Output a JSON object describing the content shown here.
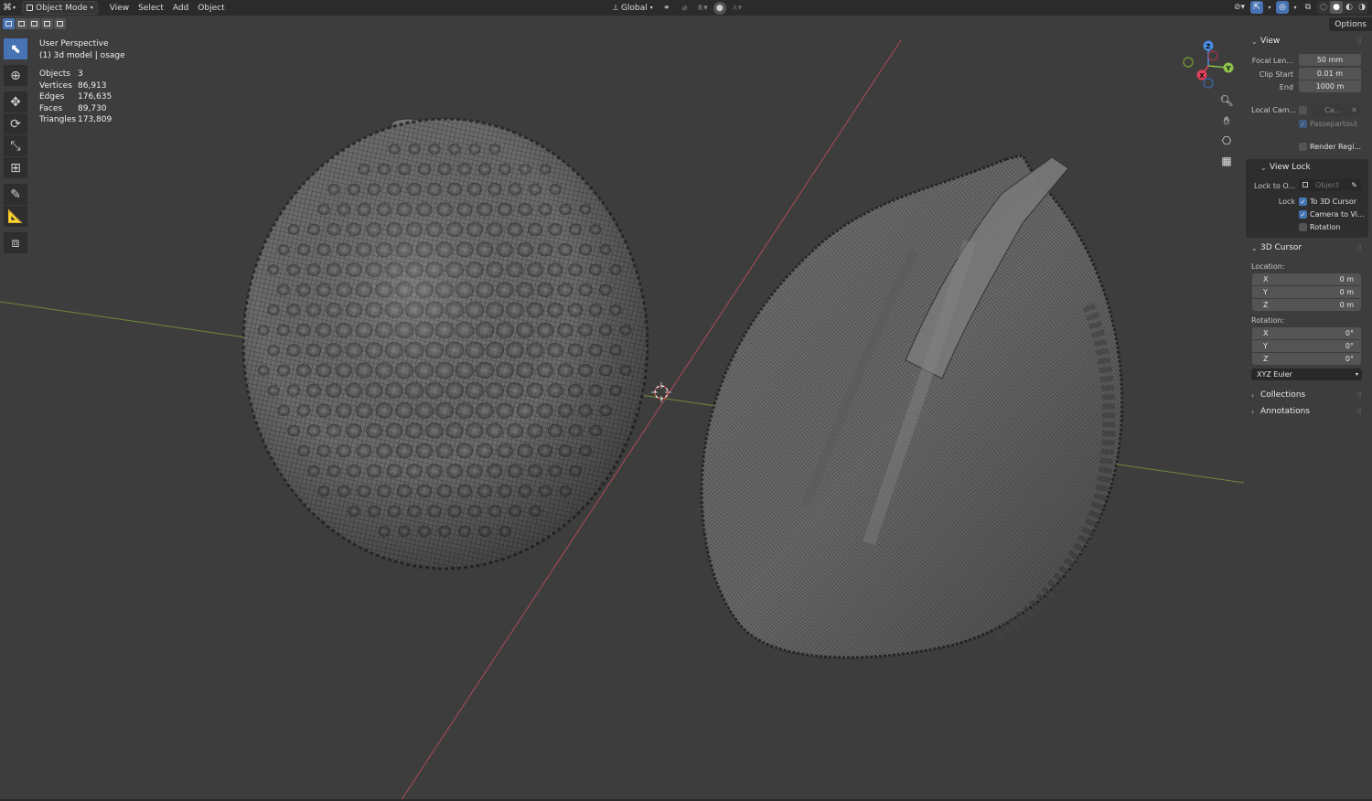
{
  "header": {
    "editor_icon": "3d-viewport-icon",
    "mode": "Object Mode",
    "menus": [
      "View",
      "Select",
      "Add",
      "Object"
    ],
    "transform_orientation": "Global"
  },
  "subrow": {
    "options_label": "Options"
  },
  "overlay": {
    "view_name": "User Perspective",
    "collection_object": "(1) 3d model | osage",
    "stats": [
      {
        "label": "Objects",
        "value": "3"
      },
      {
        "label": "Vertices",
        "value": "86,913"
      },
      {
        "label": "Edges",
        "value": "176,635"
      },
      {
        "label": "Faces",
        "value": "89,730"
      },
      {
        "label": "Triangles",
        "value": "173,809"
      }
    ]
  },
  "gizmo": {
    "z": "Z",
    "y": "Y",
    "x": "X",
    "colors": {
      "x": "#e0405a",
      "y": "#8bc34a",
      "z": "#4a8be0"
    }
  },
  "sidebar": {
    "view": {
      "title": "View",
      "focal_label": "Focal Len...",
      "focal_value": "50 mm",
      "clip_start_label": "Clip Start",
      "clip_start_value": "0.01 m",
      "clip_end_label": "End",
      "clip_end_value": "1000 m",
      "local_camera_label": "Local Cam...",
      "local_camera_value": "Ca...",
      "passepartout_label": "Passepartout",
      "render_region_label": "Render Regi..."
    },
    "view_lock": {
      "title": "View Lock",
      "lock_to_object_label": "Lock to O...",
      "lock_to_object_placeholder": "Object",
      "lock_label": "Lock",
      "to_3d_cursor_label": "To 3D Cursor",
      "camera_to_view_label": "Camera to Vi...",
      "rotation_label": "Rotation"
    },
    "cursor": {
      "title": "3D Cursor",
      "location_label": "Location:",
      "location": [
        {
          "axis": "X",
          "value": "0 m"
        },
        {
          "axis": "Y",
          "value": "0 m"
        },
        {
          "axis": "Z",
          "value": "0 m"
        }
      ],
      "rotation_label": "Rotation:",
      "rotation": [
        {
          "axis": "X",
          "value": "0°"
        },
        {
          "axis": "Y",
          "value": "0°"
        },
        {
          "axis": "Z",
          "value": "0°"
        }
      ],
      "rotation_mode": "XYZ Euler"
    },
    "collections_title": "Collections",
    "annotations_title": "Annotations"
  },
  "colors": {
    "viewport_bg": "#3d3d3d",
    "header_bg": "#2b2b2b",
    "accent": "#4772b3",
    "x_axis_line": "#b04a55",
    "y_axis_line": "#6e8a3a",
    "mesh_fill": "#6a6a6a",
    "wire": "#2a2a2a"
  }
}
